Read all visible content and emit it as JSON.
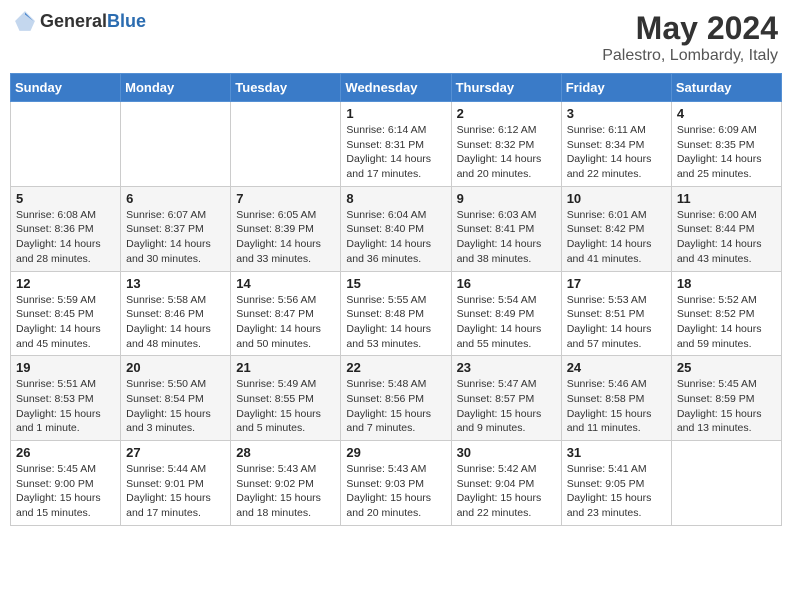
{
  "header": {
    "logo_general": "General",
    "logo_blue": "Blue",
    "month_title": "May 2024",
    "location": "Palestro, Lombardy, Italy"
  },
  "days_of_week": [
    "Sunday",
    "Monday",
    "Tuesday",
    "Wednesday",
    "Thursday",
    "Friday",
    "Saturday"
  ],
  "weeks": [
    [
      {
        "day": "",
        "info": ""
      },
      {
        "day": "",
        "info": ""
      },
      {
        "day": "",
        "info": ""
      },
      {
        "day": "1",
        "info": "Sunrise: 6:14 AM\nSunset: 8:31 PM\nDaylight: 14 hours and 17 minutes."
      },
      {
        "day": "2",
        "info": "Sunrise: 6:12 AM\nSunset: 8:32 PM\nDaylight: 14 hours and 20 minutes."
      },
      {
        "day": "3",
        "info": "Sunrise: 6:11 AM\nSunset: 8:34 PM\nDaylight: 14 hours and 22 minutes."
      },
      {
        "day": "4",
        "info": "Sunrise: 6:09 AM\nSunset: 8:35 PM\nDaylight: 14 hours and 25 minutes."
      }
    ],
    [
      {
        "day": "5",
        "info": "Sunrise: 6:08 AM\nSunset: 8:36 PM\nDaylight: 14 hours and 28 minutes."
      },
      {
        "day": "6",
        "info": "Sunrise: 6:07 AM\nSunset: 8:37 PM\nDaylight: 14 hours and 30 minutes."
      },
      {
        "day": "7",
        "info": "Sunrise: 6:05 AM\nSunset: 8:39 PM\nDaylight: 14 hours and 33 minutes."
      },
      {
        "day": "8",
        "info": "Sunrise: 6:04 AM\nSunset: 8:40 PM\nDaylight: 14 hours and 36 minutes."
      },
      {
        "day": "9",
        "info": "Sunrise: 6:03 AM\nSunset: 8:41 PM\nDaylight: 14 hours and 38 minutes."
      },
      {
        "day": "10",
        "info": "Sunrise: 6:01 AM\nSunset: 8:42 PM\nDaylight: 14 hours and 41 minutes."
      },
      {
        "day": "11",
        "info": "Sunrise: 6:00 AM\nSunset: 8:44 PM\nDaylight: 14 hours and 43 minutes."
      }
    ],
    [
      {
        "day": "12",
        "info": "Sunrise: 5:59 AM\nSunset: 8:45 PM\nDaylight: 14 hours and 45 minutes."
      },
      {
        "day": "13",
        "info": "Sunrise: 5:58 AM\nSunset: 8:46 PM\nDaylight: 14 hours and 48 minutes."
      },
      {
        "day": "14",
        "info": "Sunrise: 5:56 AM\nSunset: 8:47 PM\nDaylight: 14 hours and 50 minutes."
      },
      {
        "day": "15",
        "info": "Sunrise: 5:55 AM\nSunset: 8:48 PM\nDaylight: 14 hours and 53 minutes."
      },
      {
        "day": "16",
        "info": "Sunrise: 5:54 AM\nSunset: 8:49 PM\nDaylight: 14 hours and 55 minutes."
      },
      {
        "day": "17",
        "info": "Sunrise: 5:53 AM\nSunset: 8:51 PM\nDaylight: 14 hours and 57 minutes."
      },
      {
        "day": "18",
        "info": "Sunrise: 5:52 AM\nSunset: 8:52 PM\nDaylight: 14 hours and 59 minutes."
      }
    ],
    [
      {
        "day": "19",
        "info": "Sunrise: 5:51 AM\nSunset: 8:53 PM\nDaylight: 15 hours and 1 minute."
      },
      {
        "day": "20",
        "info": "Sunrise: 5:50 AM\nSunset: 8:54 PM\nDaylight: 15 hours and 3 minutes."
      },
      {
        "day": "21",
        "info": "Sunrise: 5:49 AM\nSunset: 8:55 PM\nDaylight: 15 hours and 5 minutes."
      },
      {
        "day": "22",
        "info": "Sunrise: 5:48 AM\nSunset: 8:56 PM\nDaylight: 15 hours and 7 minutes."
      },
      {
        "day": "23",
        "info": "Sunrise: 5:47 AM\nSunset: 8:57 PM\nDaylight: 15 hours and 9 minutes."
      },
      {
        "day": "24",
        "info": "Sunrise: 5:46 AM\nSunset: 8:58 PM\nDaylight: 15 hours and 11 minutes."
      },
      {
        "day": "25",
        "info": "Sunrise: 5:45 AM\nSunset: 8:59 PM\nDaylight: 15 hours and 13 minutes."
      }
    ],
    [
      {
        "day": "26",
        "info": "Sunrise: 5:45 AM\nSunset: 9:00 PM\nDaylight: 15 hours and 15 minutes."
      },
      {
        "day": "27",
        "info": "Sunrise: 5:44 AM\nSunset: 9:01 PM\nDaylight: 15 hours and 17 minutes."
      },
      {
        "day": "28",
        "info": "Sunrise: 5:43 AM\nSunset: 9:02 PM\nDaylight: 15 hours and 18 minutes."
      },
      {
        "day": "29",
        "info": "Sunrise: 5:43 AM\nSunset: 9:03 PM\nDaylight: 15 hours and 20 minutes."
      },
      {
        "day": "30",
        "info": "Sunrise: 5:42 AM\nSunset: 9:04 PM\nDaylight: 15 hours and 22 minutes."
      },
      {
        "day": "31",
        "info": "Sunrise: 5:41 AM\nSunset: 9:05 PM\nDaylight: 15 hours and 23 minutes."
      },
      {
        "day": "",
        "info": ""
      }
    ]
  ]
}
